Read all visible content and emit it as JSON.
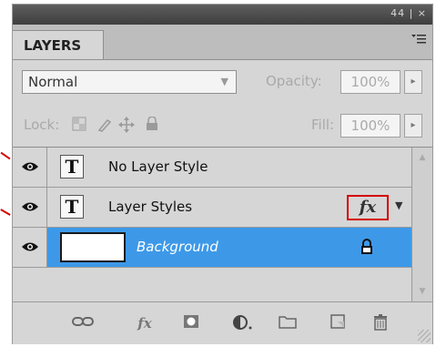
{
  "panel": {
    "tab_label": "LAYERS",
    "titlebar_icons": "44 | ×",
    "menu_icon": "panel-menu-icon"
  },
  "blend": {
    "mode": "Normal",
    "opacity_label": "Opacity:",
    "opacity_value": "100%"
  },
  "lock": {
    "label": "Lock:",
    "fill_label": "Fill:",
    "fill_value": "100%",
    "icons": [
      "lock-transparent-icon",
      "lock-image-icon",
      "lock-position-icon",
      "lock-all-icon"
    ]
  },
  "layers": [
    {
      "name": "No Layer Style",
      "type": "text",
      "thumb_glyph": "T",
      "visible": true
    },
    {
      "name": "Layer Styles",
      "type": "text",
      "thumb_glyph": "T",
      "visible": true,
      "effects_badge": "fx"
    },
    {
      "name": "Background",
      "type": "image",
      "visible": true,
      "locked": true,
      "selected": true
    }
  ],
  "bottom_toolbar": {
    "icons": [
      "link-layers-icon",
      "fx-icon",
      "mask-icon",
      "adjustment-layer-icon",
      "new-group-icon",
      "new-layer-icon",
      "delete-icon"
    ],
    "fx_label": "fx"
  },
  "colors": {
    "selection": "#3d99e8",
    "highlight_border": "#d40000",
    "panel_bg": "#d6d6d6"
  }
}
